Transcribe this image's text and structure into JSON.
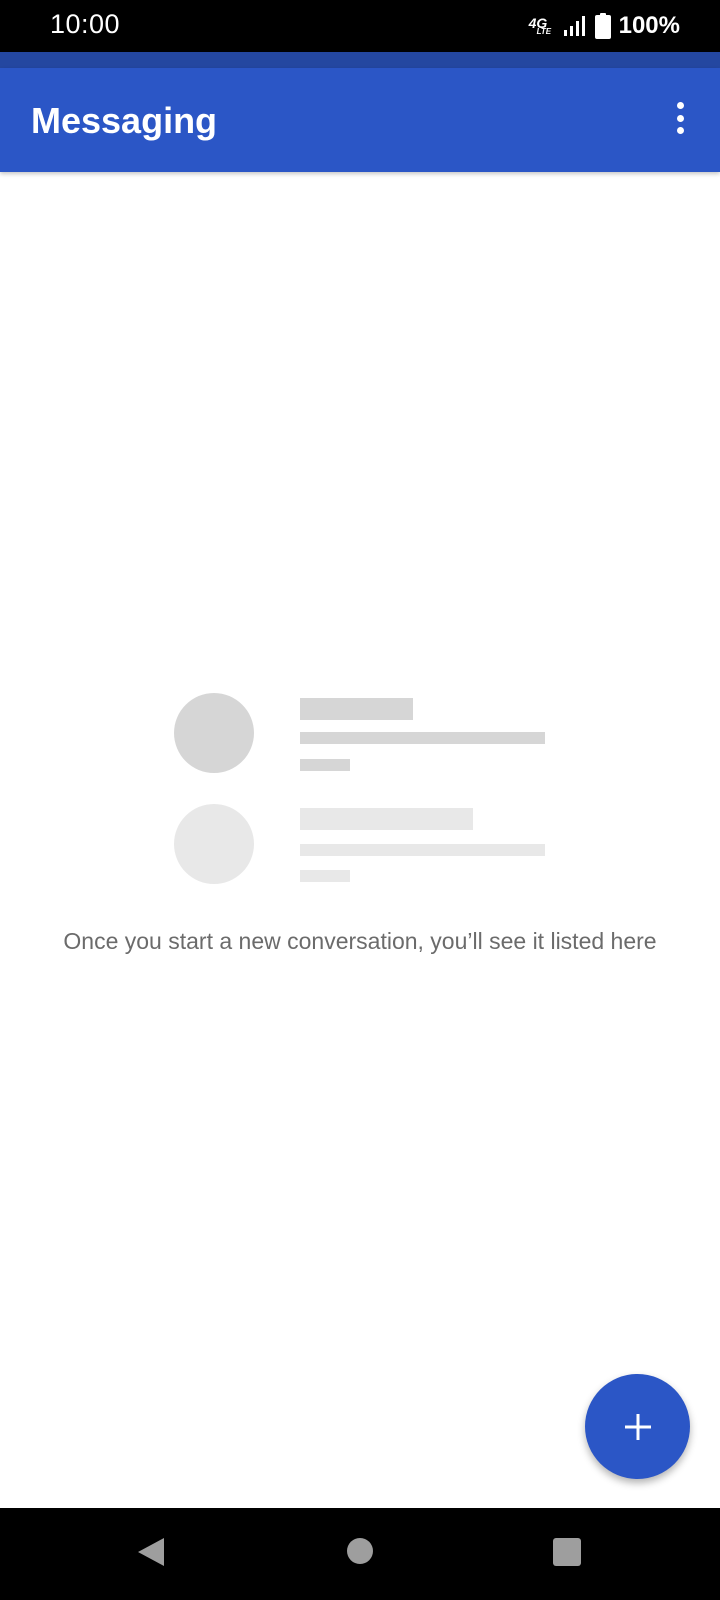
{
  "status_bar": {
    "time": "10:00",
    "network_top": "4G",
    "network_bottom": "LTE",
    "battery_percent": "100%",
    "icons": [
      "signal-icon",
      "battery-icon"
    ]
  },
  "app_bar": {
    "title": "Messaging",
    "menu_icon": "more-vert-icon"
  },
  "empty_state": {
    "message": "Once you start a new conversation, you’ll see it listed here"
  },
  "fab": {
    "icon": "plus-icon"
  },
  "nav_bar": {
    "icons": [
      "back-icon",
      "home-icon",
      "recents-icon"
    ]
  },
  "colors": {
    "primary": "#2b56c6",
    "status_strip": "#2447a0",
    "placeholder_dark": "#d6d6d6",
    "placeholder_light": "#e8e8e8",
    "empty_text": "#6b6b6b"
  }
}
